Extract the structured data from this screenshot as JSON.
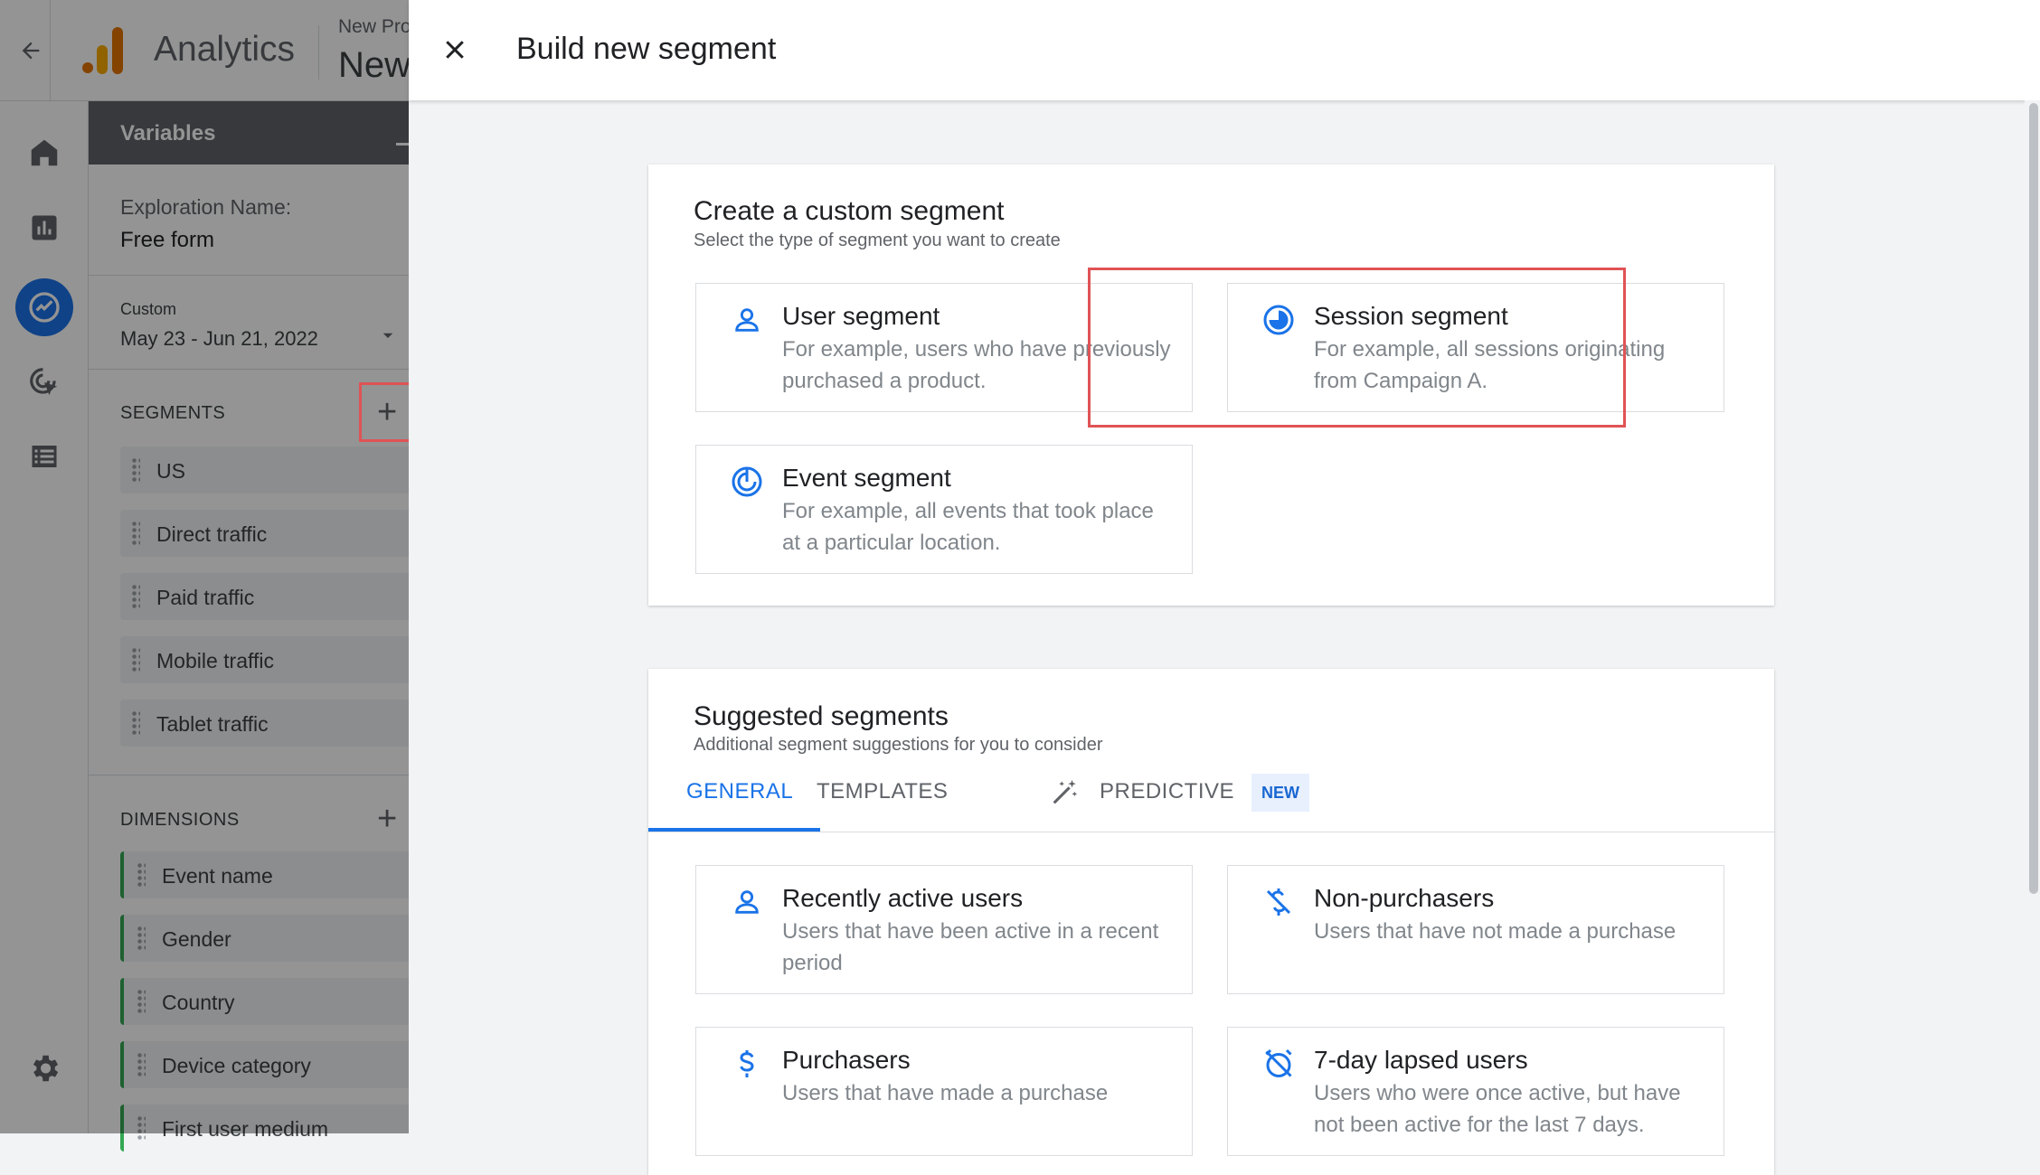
{
  "topbar": {
    "app_name": "Analytics",
    "property_label": "New Pro",
    "property_name": "New"
  },
  "variables": {
    "title": "Variables",
    "exploration_label": "Exploration Name:",
    "exploration_value": "Free form",
    "date_label": "Custom",
    "date_range": "May 23 - Jun 21, 2022",
    "segments_title": "SEGMENTS",
    "segments": [
      "US",
      "Direct traffic",
      "Paid traffic",
      "Mobile traffic",
      "Tablet traffic"
    ],
    "dimensions_title": "DIMENSIONS",
    "dimensions": [
      "Event name",
      "Gender",
      "Country",
      "Device category",
      "First user medium"
    ]
  },
  "dialog": {
    "title": "Build new segment",
    "custom": {
      "title": "Create a custom segment",
      "subtitle": "Select the type of segment you want to create",
      "options": [
        {
          "title": "User segment",
          "desc": "For example, users who have previously purchased a product."
        },
        {
          "title": "Session segment",
          "desc": "For example, all sessions originating from Campaign A."
        },
        {
          "title": "Event segment",
          "desc": "For example, all events that took place at a particular location."
        }
      ]
    },
    "suggested": {
      "title": "Suggested segments",
      "subtitle": "Additional segment suggestions for you to consider",
      "tabs": [
        "GENERAL",
        "TEMPLATES",
        "PREDICTIVE"
      ],
      "new_badge": "NEW",
      "items": [
        {
          "title": "Recently active users",
          "desc": "Users that have been active in a recent period"
        },
        {
          "title": "Non-purchasers",
          "desc": "Users that have not made a purchase"
        },
        {
          "title": "Purchasers",
          "desc": "Users that have made a purchase"
        },
        {
          "title": "7-day lapsed users",
          "desc": "Users who were once active, but have not been active for the last 7 days."
        }
      ]
    }
  },
  "colors": {
    "accent": "#1a73e8",
    "highlight": "#e05355",
    "dimension_bar": "#34a853"
  }
}
